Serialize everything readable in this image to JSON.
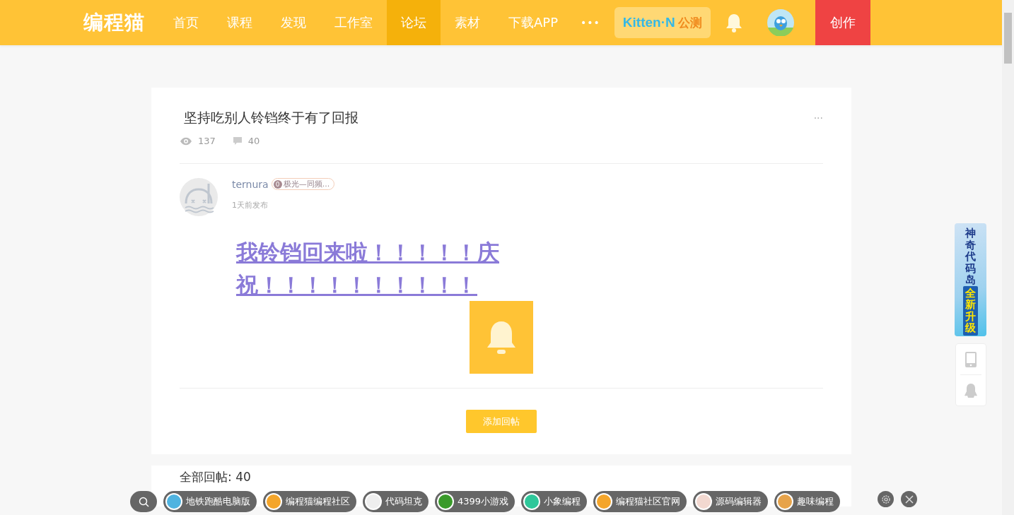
{
  "header": {
    "logo": "编程猫",
    "nav": [
      {
        "label": "首页",
        "selected": false
      },
      {
        "label": "课程",
        "selected": false
      },
      {
        "label": "发现",
        "selected": false
      },
      {
        "label": "工作室",
        "selected": false
      },
      {
        "label": "论坛",
        "selected": true
      },
      {
        "label": "素材",
        "selected": false
      },
      {
        "label": "下载APP",
        "selected": false
      }
    ],
    "more": "•••",
    "badge": {
      "brand": "Kitten·N",
      "tag": "公测"
    },
    "create_button": "创作"
  },
  "post": {
    "title": "坚持吃别人铃铛终于有了回报",
    "menu": "···",
    "views": "137",
    "comments": "40",
    "author": "ternura",
    "medal": {
      "number": "0",
      "text": "极光—同频..."
    },
    "time": "1天前发布",
    "content": "我铃铛回来啦！！！！！庆祝！！！！！！！！！！",
    "reply_button": "添加回帖"
  },
  "replies": {
    "heading": "全部回帖: 40"
  },
  "side": {
    "banner": [
      "神奇代码岛",
      "全新升级"
    ]
  },
  "link_bar": {
    "links": [
      {
        "label": "地铁跑酷电脑版",
        "color": "#4fb3e0"
      },
      {
        "label": "编程猫编程社区",
        "color": "#f4a52a"
      },
      {
        "label": "代码坦克",
        "color": "#eeeeee"
      },
      {
        "label": "4399小游戏",
        "color": "#3a9a2a"
      },
      {
        "label": "小象编程",
        "color": "#2fc79a"
      },
      {
        "label": "编程猫社区官网",
        "color": "#f4a52a"
      },
      {
        "label": "源码编辑器",
        "color": "#f2d8d0"
      },
      {
        "label": "趣味编程",
        "color": "#e7a34a"
      }
    ]
  }
}
